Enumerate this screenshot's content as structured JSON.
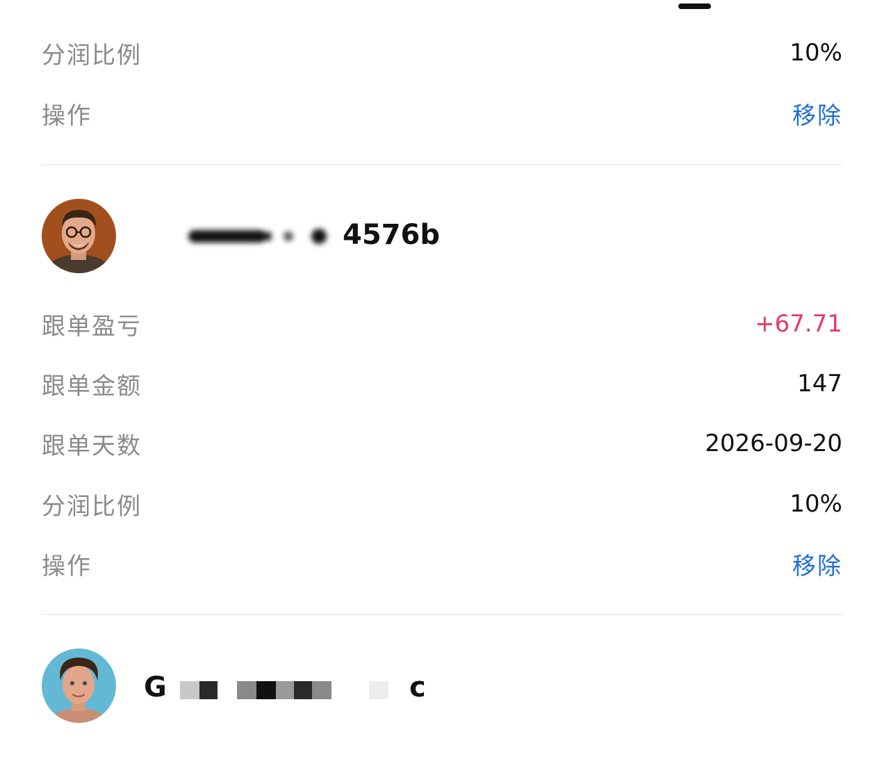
{
  "section_1": {
    "rows": [
      {
        "label": "分润比例",
        "value": "10%"
      },
      {
        "label": "操作",
        "value": "移除"
      }
    ]
  },
  "section_2": {
    "user": {
      "name_visible_suffix": "4576b"
    },
    "rows": [
      {
        "label": "跟单盈亏",
        "value": "+67.71"
      },
      {
        "label": "跟单金额",
        "value": "147"
      },
      {
        "label": "跟单天数",
        "value": "2026-09-20"
      },
      {
        "label": "分润比例",
        "value": "10%"
      },
      {
        "label": "操作",
        "value": "移除"
      }
    ]
  },
  "section_3": {
    "user": {
      "name_visible_start": "G",
      "name_visible_end": "c"
    }
  },
  "colors": {
    "label": "#8a8a8a",
    "value": "#111111",
    "profit_positive": "#e23b63",
    "link": "#1e6fd9",
    "divider": "#f0f0f0"
  }
}
